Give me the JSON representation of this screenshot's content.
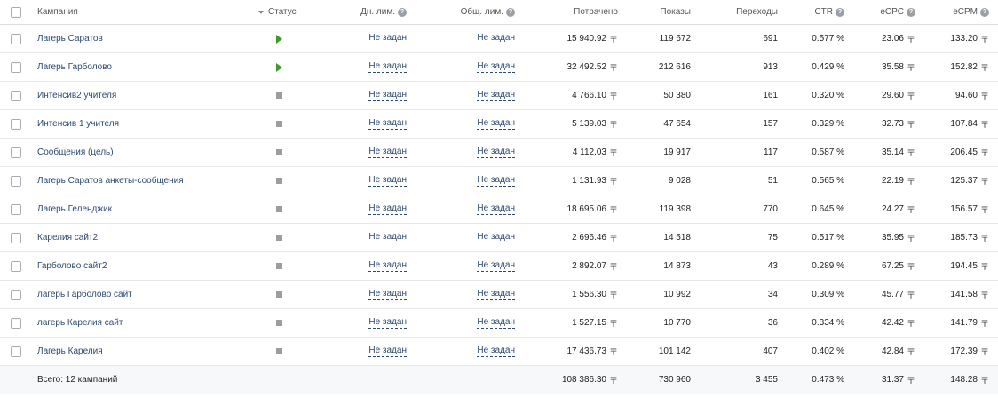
{
  "header": {
    "campaign": "Кампания",
    "status": "Статус",
    "daily_limit": "Дн. лим.",
    "total_limit": "Общ. лим.",
    "spent": "Потрачено",
    "impressions": "Показы",
    "clicks": "Переходы",
    "ctr": "CTR",
    "ecpc": "eCPC",
    "ecpm": "eCPM"
  },
  "currency_symbol": "〒",
  "rows": [
    {
      "name": "Лагерь Саратов",
      "status": "play",
      "daily": "Не задан",
      "total": "Не задан",
      "spent": "15 940.92",
      "impressions": "119 672",
      "clicks": "691",
      "ctr": "0.577 %",
      "ecpc": "23.06",
      "ecpm": "133.20"
    },
    {
      "name": "Лагерь Гарболово",
      "status": "play",
      "daily": "Не задан",
      "total": "Не задан",
      "spent": "32 492.52",
      "impressions": "212 616",
      "clicks": "913",
      "ctr": "0.429 %",
      "ecpc": "35.58",
      "ecpm": "152.82"
    },
    {
      "name": "Интенсив2 учителя",
      "status": "stop",
      "daily": "Не задан",
      "total": "Не задан",
      "spent": "4 766.10",
      "impressions": "50 380",
      "clicks": "161",
      "ctr": "0.320 %",
      "ecpc": "29.60",
      "ecpm": "94.60"
    },
    {
      "name": "Интенсив 1 учителя",
      "status": "stop",
      "daily": "Не задан",
      "total": "Не задан",
      "spent": "5 139.03",
      "impressions": "47 654",
      "clicks": "157",
      "ctr": "0.329 %",
      "ecpc": "32.73",
      "ecpm": "107.84"
    },
    {
      "name": "Сообщения (цель)",
      "status": "stop",
      "daily": "Не задан",
      "total": "Не задан",
      "spent": "4 112.03",
      "impressions": "19 917",
      "clicks": "117",
      "ctr": "0.587 %",
      "ecpc": "35.14",
      "ecpm": "206.45"
    },
    {
      "name": "Лагерь Саратов анкеты-сообщения",
      "status": "stop",
      "daily": "Не задан",
      "total": "Не задан",
      "spent": "1 131.93",
      "impressions": "9 028",
      "clicks": "51",
      "ctr": "0.565 %",
      "ecpc": "22.19",
      "ecpm": "125.37"
    },
    {
      "name": "Лагерь Геленджик",
      "status": "stop",
      "daily": "Не задан",
      "total": "Не задан",
      "spent": "18 695.06",
      "impressions": "119 398",
      "clicks": "770",
      "ctr": "0.645 %",
      "ecpc": "24.27",
      "ecpm": "156.57"
    },
    {
      "name": "Карелия сайт2",
      "status": "stop",
      "daily": "Не задан",
      "total": "Не задан",
      "spent": "2 696.46",
      "impressions": "14 518",
      "clicks": "75",
      "ctr": "0.517 %",
      "ecpc": "35.95",
      "ecpm": "185.73"
    },
    {
      "name": "Гарболово сайт2",
      "status": "stop",
      "daily": "Не задан",
      "total": "Не задан",
      "spent": "2 892.07",
      "impressions": "14 873",
      "clicks": "43",
      "ctr": "0.289 %",
      "ecpc": "67.25",
      "ecpm": "194.45"
    },
    {
      "name": "лагерь Гарболово сайт",
      "status": "stop",
      "daily": "Не задан",
      "total": "Не задан",
      "spent": "1 556.30",
      "impressions": "10 992",
      "clicks": "34",
      "ctr": "0.309 %",
      "ecpc": "45.77",
      "ecpm": "141.58"
    },
    {
      "name": "лагерь Карелия сайт",
      "status": "stop",
      "daily": "Не задан",
      "total": "Не задан",
      "spent": "1 527.15",
      "impressions": "10 770",
      "clicks": "36",
      "ctr": "0.334 %",
      "ecpc": "42.42",
      "ecpm": "141.79"
    },
    {
      "name": "Лагерь Карелия",
      "status": "stop",
      "daily": "Не задан",
      "total": "Не задан",
      "spent": "17 436.73",
      "impressions": "101 142",
      "clicks": "407",
      "ctr": "0.402 %",
      "ecpc": "42.84",
      "ecpm": "172.39"
    }
  ],
  "footer": {
    "label": "Всего: 12 кампаний",
    "spent": "108 386.30",
    "impressions": "730 960",
    "clicks": "3 455",
    "ctr": "0.473 %",
    "ecpc": "31.37",
    "ecpm": "148.28"
  },
  "colors": {
    "link": "#2b4a6f",
    "play": "#3e9a2c",
    "stop": "#9a9ea3"
  }
}
